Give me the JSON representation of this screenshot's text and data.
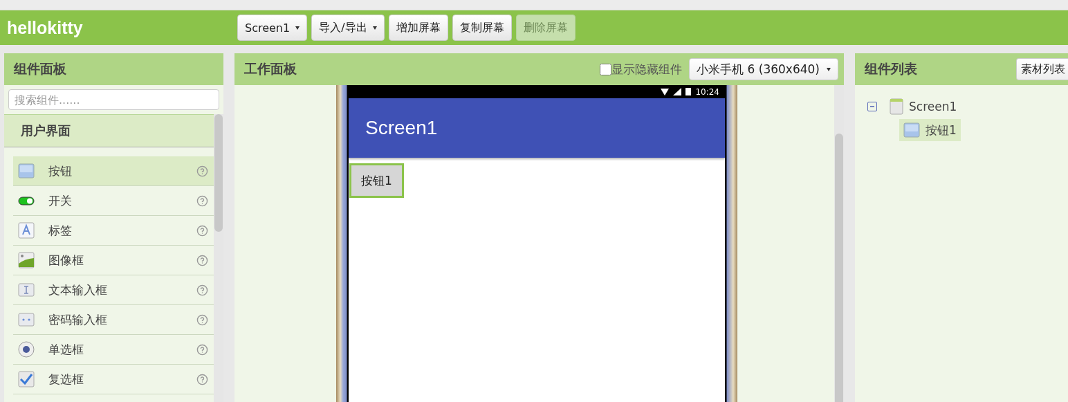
{
  "app": {
    "title": "hellokitty"
  },
  "toolbar": [
    {
      "label": "Screen1",
      "kind": "dropdown",
      "disabled": false
    },
    {
      "label": "导入/导出",
      "kind": "dropdown",
      "disabled": false
    },
    {
      "label": "增加屏幕",
      "kind": "plain",
      "disabled": false
    },
    {
      "label": "复制屏幕",
      "kind": "plain",
      "disabled": false
    },
    {
      "label": "删除屏幕",
      "kind": "plain",
      "disabled": true
    }
  ],
  "palette": {
    "title": "组件面板",
    "search": {
      "placeholder": "搜索组件......"
    },
    "category": "用户界面",
    "items": [
      {
        "label": "按钮",
        "kind": "button",
        "selected": true
      },
      {
        "label": "开关",
        "kind": "switch",
        "selected": false
      },
      {
        "label": "标签",
        "kind": "label",
        "selected": false
      },
      {
        "label": "图像框",
        "kind": "image",
        "selected": false
      },
      {
        "label": "文本输入框",
        "kind": "textbox",
        "selected": false
      },
      {
        "label": "密码输入框",
        "kind": "password",
        "selected": false
      },
      {
        "label": "单选框",
        "kind": "radio",
        "selected": false
      },
      {
        "label": "复选框",
        "kind": "checkbox",
        "selected": false
      }
    ]
  },
  "viewer": {
    "title": "工作面板",
    "show_hidden": {
      "label": "显示隐藏组件",
      "checked": false
    },
    "device": "小米手机 6 (360x640)",
    "phone": {
      "time": "10:24",
      "screen_title": "Screen1",
      "components": [
        {
          "label": "按钮1",
          "selected": true
        }
      ]
    }
  },
  "components": {
    "title": "组件列表",
    "assets_button": "素材列表",
    "tree": [
      {
        "label": "Screen1",
        "expanded": true,
        "selected": false,
        "children": [
          {
            "label": "按钮1",
            "selected": true
          }
        ]
      }
    ]
  }
}
